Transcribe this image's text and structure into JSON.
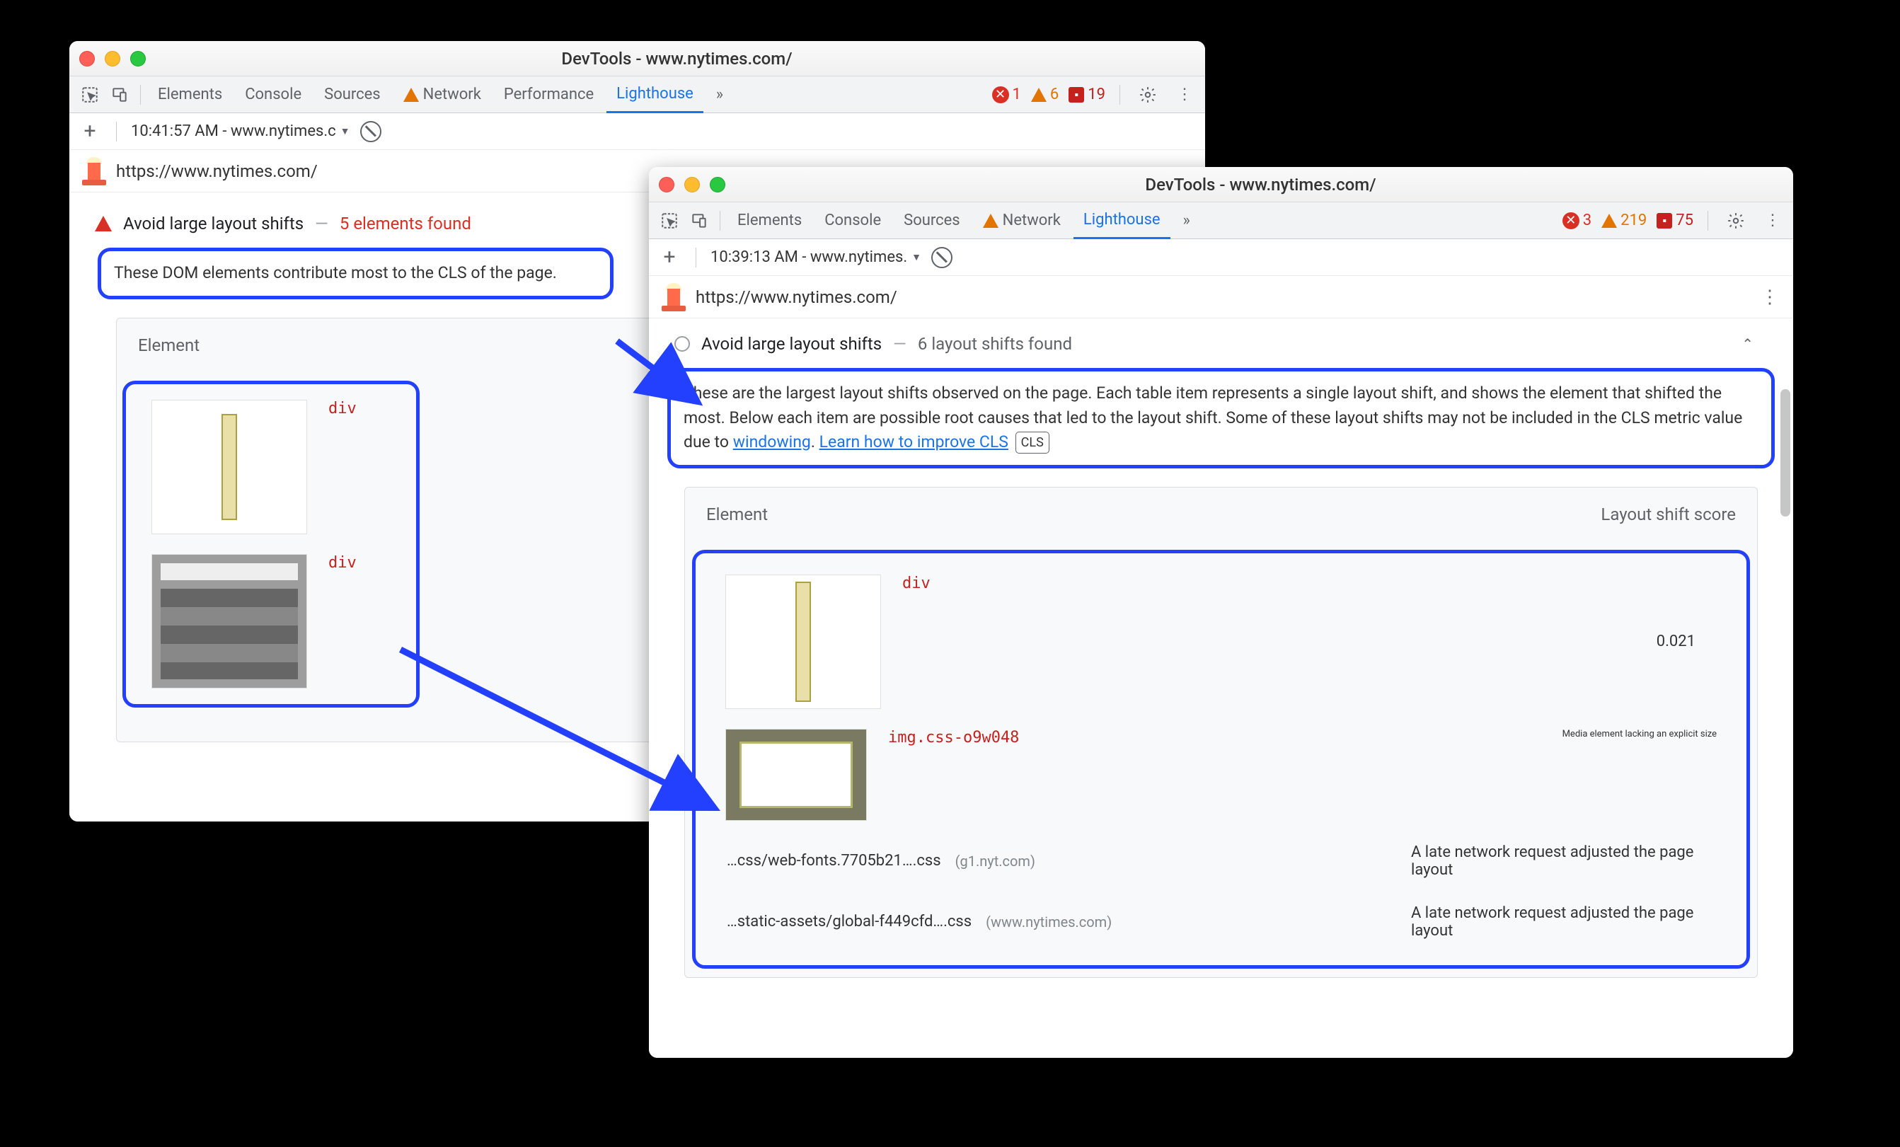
{
  "win1": {
    "title": "DevTools - www.nytimes.com/",
    "tabs": {
      "elements": "Elements",
      "console": "Console",
      "sources": "Sources",
      "network": "Network",
      "performance": "Performance",
      "lighthouse": "Lighthouse"
    },
    "status": {
      "errors": "1",
      "warnings": "6",
      "issues": "19"
    },
    "session": "10:41:57 AM - www.nytimes.c",
    "url": "https://www.nytimes.com/",
    "audit": {
      "title": "Avoid large layout shifts",
      "dash": "—",
      "found": "5 elements found"
    },
    "desc": "These DOM elements contribute most to the CLS of the page.",
    "table": {
      "header_element": "Element"
    },
    "rows": [
      {
        "label": "div"
      },
      {
        "label": "div"
      }
    ]
  },
  "win2": {
    "title": "DevTools - www.nytimes.com/",
    "tabs": {
      "elements": "Elements",
      "console": "Console",
      "sources": "Sources",
      "network": "Network",
      "lighthouse": "Lighthouse"
    },
    "status": {
      "errors": "3",
      "warnings": "219",
      "issues": "75"
    },
    "session": "10:39:13 AM - www.nytimes.",
    "url": "https://www.nytimes.com/",
    "audit": {
      "title": "Avoid large layout shifts",
      "dash": "—",
      "found": "6 layout shifts found"
    },
    "desc_pre": "These are the largest layout shifts observed on the page. Each table item represents a single layout shift, and shows the element that shifted the most. Below each item are possible root causes that led to the layout shift. Some of these layout shifts may not be included in the CLS metric value due to ",
    "link1": "windowing",
    "desc_mid": ". ",
    "link2": "Learn how to improve CLS",
    "cls_tag": "CLS",
    "table": {
      "header_element": "Element",
      "header_score": "Layout shift score"
    },
    "row0": {
      "label": "div",
      "score": "0.021"
    },
    "row1": {
      "label": "img.css-o9w048",
      "cause": "Media element lacking an explicit size"
    },
    "details": [
      {
        "file": "…css/web-fonts.7705b21….css",
        "host": "(g1.nyt.com)",
        "cause": "A late network request adjusted the page layout"
      },
      {
        "file": "…static-assets/global-f449cfd….css",
        "host": "(www.nytimes.com)",
        "cause": "A late network request adjusted the page layout"
      }
    ]
  }
}
